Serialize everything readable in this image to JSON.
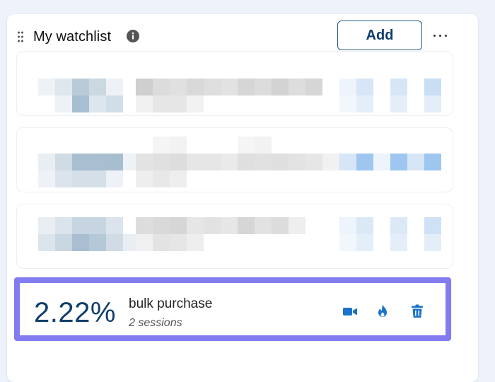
{
  "header": {
    "title": "My watchlist",
    "add_label": "Add",
    "drag_icon": "drag-handle-icon",
    "info_icon": "info-icon",
    "more_icon": "more-horizontal-icon"
  },
  "selected_row": {
    "value": "2.22%",
    "label": "bulk purchase",
    "sublabel": "2 sessions",
    "actions": [
      "video-camera-icon",
      "flame-icon",
      "trash-icon"
    ]
  },
  "colors": {
    "accent": "#0f3e6b",
    "action_blue": "#1a73c9",
    "selection_border": "#837cf1",
    "background": "#eef3fb"
  }
}
